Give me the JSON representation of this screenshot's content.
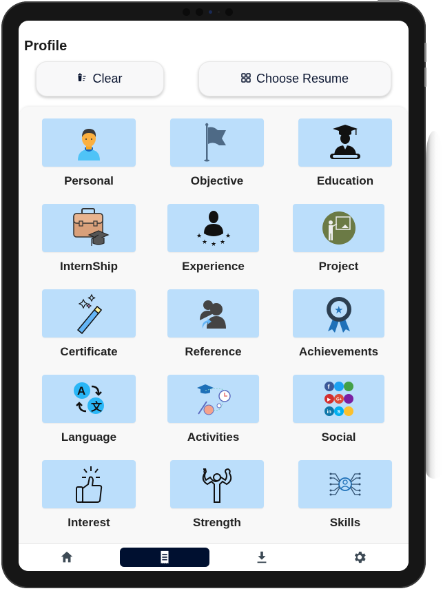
{
  "header": {
    "title": "Profile"
  },
  "toolbar": {
    "clear_label": "Clear",
    "clear_icon": "trash-list-icon",
    "choose_resume_label": "Choose Resume",
    "choose_resume_icon": "grid-icon"
  },
  "sections": [
    {
      "label": "Personal",
      "icon": "person-icon"
    },
    {
      "label": "Objective",
      "icon": "flag-icon"
    },
    {
      "label": "Education",
      "icon": "graduate-icon"
    },
    {
      "label": "InternShip",
      "icon": "briefcase-cap-icon"
    },
    {
      "label": "Experience",
      "icon": "person-stars-icon"
    },
    {
      "label": "Project",
      "icon": "presentation-icon"
    },
    {
      "label": "Certificate",
      "icon": "magic-wand-icon"
    },
    {
      "label": "Reference",
      "icon": "people-refer-icon"
    },
    {
      "label": "Achievements",
      "icon": "award-ribbon-icon"
    },
    {
      "label": "Language",
      "icon": "translate-icon"
    },
    {
      "label": "Activities",
      "icon": "activities-icon"
    },
    {
      "label": "Social",
      "icon": "social-media-icon"
    },
    {
      "label": "Interest",
      "icon": "thumbs-up-icon"
    },
    {
      "label": "Strength",
      "icon": "strong-person-icon"
    },
    {
      "label": "Skills",
      "icon": "skills-network-icon"
    }
  ],
  "bottom_nav": [
    {
      "name": "home",
      "icon": "home-icon",
      "active": false
    },
    {
      "name": "resume",
      "icon": "receipt-icon",
      "active": true
    },
    {
      "name": "download",
      "icon": "download-icon",
      "active": false
    },
    {
      "name": "settings",
      "icon": "gear-icon",
      "active": false
    }
  ],
  "colors": {
    "tile_bg": "#bbdefb",
    "active_nav": "#001030",
    "text_dark": "#0a1530"
  }
}
